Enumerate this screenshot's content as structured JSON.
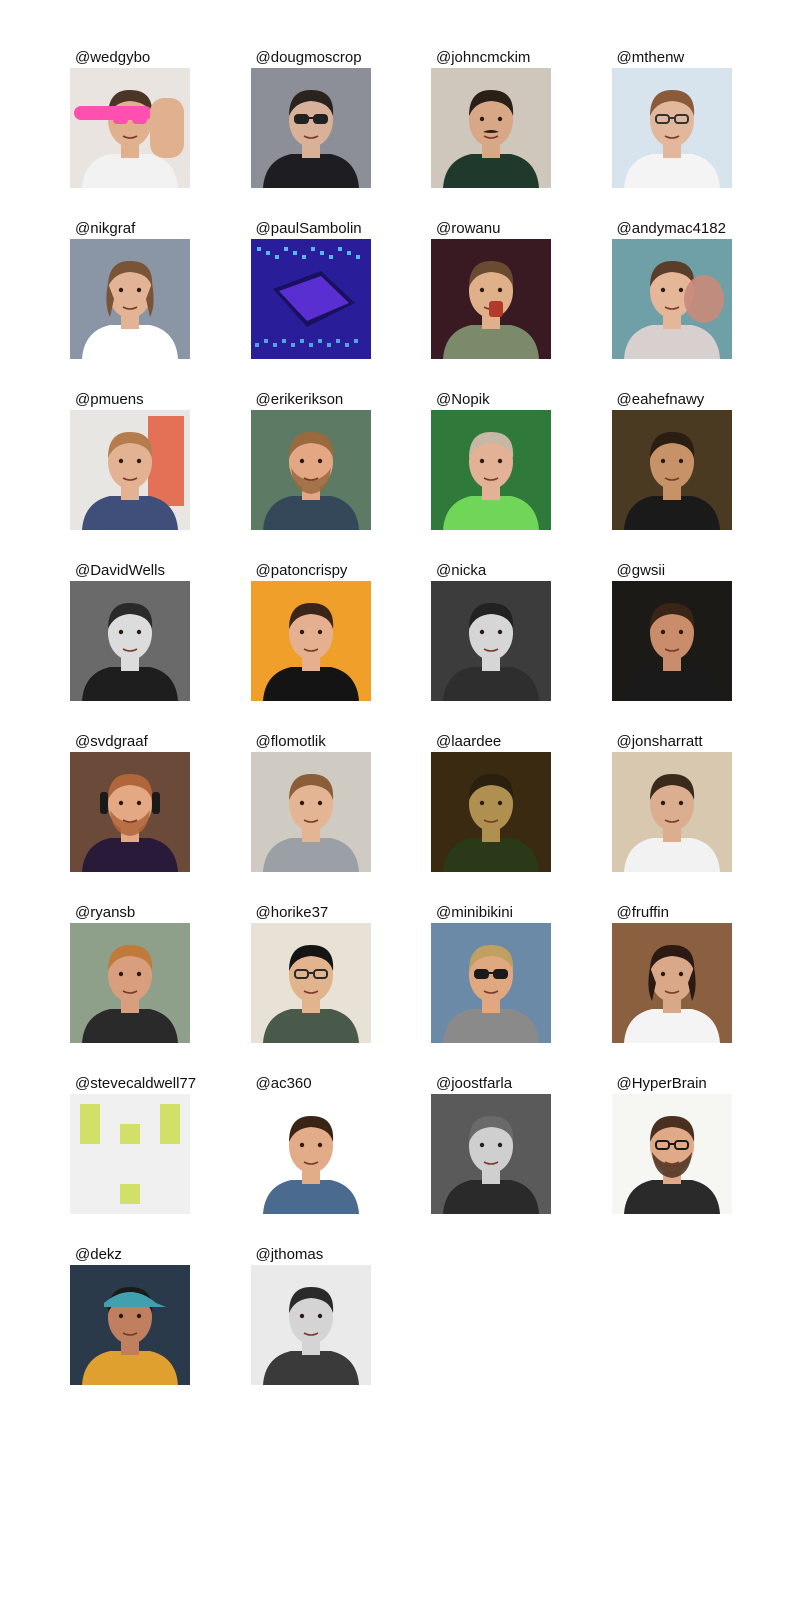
{
  "contributors": [
    {
      "handle": "@wedgybo",
      "avatar": "person-with-rainbow-sunglasses-portrait",
      "palette": {
        "bg": "#e9e4df",
        "skin": "#e0b08f",
        "hair": "#4a3526",
        "shirt": "#f2f2f2",
        "extra": "#ff4fb0"
      }
    },
    {
      "handle": "@dougmoscrop",
      "avatar": "person-with-sunglasses-portrait",
      "palette": {
        "bg": "#8c8f97",
        "skin": "#d9b098",
        "hair": "#2a2320",
        "shirt": "#1e1e22",
        "extra": "#222222"
      }
    },
    {
      "handle": "@johncmckim",
      "avatar": "person-with-mustache-portrait",
      "palette": {
        "bg": "#cfc7bb",
        "skin": "#d8a886",
        "hair": "#2b2018",
        "shirt": "#1f3a2c",
        "extra": "#8aa39a"
      }
    },
    {
      "handle": "@mthenw",
      "avatar": "person-with-glasses-portrait",
      "palette": {
        "bg": "#d7e4ee",
        "skin": "#e3b79c",
        "hair": "#8a5a3a",
        "shirt": "#f4f4f4",
        "extra": "#333333"
      }
    },
    {
      "handle": "@nikgraf",
      "avatar": "person-long-hair-portrait",
      "palette": {
        "bg": "#8a96a6",
        "skin": "#e2b394",
        "hair": "#7a5436",
        "shirt": "#ffffff",
        "extra": "#5c6a7c"
      }
    },
    {
      "handle": "@paulSambolin",
      "avatar": "microchip-photo",
      "palette": {
        "bg": "#2a1d9a",
        "skin": "#5a2fd1",
        "hair": "#3a1c8a",
        "shirt": "#1a1060",
        "extra": "#62e0ff"
      }
    },
    {
      "handle": "@rowanu",
      "avatar": "person-drinking-portrait",
      "palette": {
        "bg": "#3a1a22",
        "skin": "#e0b08a",
        "hair": "#6a4a30",
        "shirt": "#7b8a6a",
        "extra": "#b23a2a"
      }
    },
    {
      "handle": "@andymac4182",
      "avatar": "couple-portrait",
      "palette": {
        "bg": "#6fa0a8",
        "skin": "#e6b699",
        "hair": "#5a3e2a",
        "shirt": "#d7d0cf",
        "extra": "#c98a79"
      }
    },
    {
      "handle": "@pmuens",
      "avatar": "speaker-on-stage-photo",
      "palette": {
        "bg": "#e8e6e3",
        "skin": "#e3b293",
        "hair": "#b57d4e",
        "shirt": "#3f4f7a",
        "extra": "#e35a3c"
      }
    },
    {
      "handle": "@erikerikson",
      "avatar": "bearded-person-portrait",
      "palette": {
        "bg": "#5c7a64",
        "skin": "#e4a784",
        "hair": "#9a6a3e",
        "shirt": "#35485a",
        "extra": "#a7b9c8"
      }
    },
    {
      "handle": "@Nopik",
      "avatar": "person-relaxing-portrait",
      "palette": {
        "bg": "#2f7a3a",
        "skin": "#e2b196",
        "hair": "#c7b8a6",
        "shirt": "#6fd65a",
        "extra": "#1b1b1b"
      }
    },
    {
      "handle": "@eahefnawy",
      "avatar": "person-smiling-portrait",
      "palette": {
        "bg": "#4a3a22",
        "skin": "#c89268",
        "hair": "#2a1d12",
        "shirt": "#1a1a1a",
        "extra": "#d8b040"
      }
    },
    {
      "handle": "@DavidWells",
      "avatar": "person-black-and-white-portrait",
      "palette": {
        "bg": "#6a6a6a",
        "skin": "#dcdcdc",
        "hair": "#2a2a2a",
        "shirt": "#1e1e1e",
        "extra": "#9a9a9a"
      }
    },
    {
      "handle": "@patoncrispy",
      "avatar": "person-in-suit-portrait",
      "palette": {
        "bg": "#f0a02a",
        "skin": "#e4b090",
        "hair": "#3a2518",
        "shirt": "#141414",
        "extra": "#ffffff"
      }
    },
    {
      "handle": "@nicka",
      "avatar": "person-black-and-white-portrait",
      "palette": {
        "bg": "#3c3c3c",
        "skin": "#d6d6d6",
        "hair": "#222222",
        "shirt": "#2e2e2e",
        "extra": "#8c8c8c"
      }
    },
    {
      "handle": "@gwsii",
      "avatar": "person-squinting-portrait",
      "palette": {
        "bg": "#1c1a16",
        "skin": "#c98d6c",
        "hair": "#3a2418",
        "shirt": "#1a1a1a",
        "extra": "#5a4030"
      }
    },
    {
      "handle": "@svdgraaf",
      "avatar": "person-with-headphones-portrait",
      "palette": {
        "bg": "#6b4a3a",
        "skin": "#e4a884",
        "hair": "#b0653a",
        "shirt": "#2a1a3a",
        "extra": "#1a1a1a"
      }
    },
    {
      "handle": "@flomotlik",
      "avatar": "person-smiling-portrait",
      "palette": {
        "bg": "#cfcac2",
        "skin": "#e3b594",
        "hair": "#8a5e38",
        "shirt": "#9aa0a6",
        "extra": "#7a8088"
      }
    },
    {
      "handle": "@laardee",
      "avatar": "person-in-dim-light-portrait",
      "palette": {
        "bg": "#3a2a12",
        "skin": "#b09050",
        "hair": "#2a2010",
        "shirt": "#2a3a18",
        "extra": "#d08a2a"
      }
    },
    {
      "handle": "@jonsharratt",
      "avatar": "person-vintage-portrait",
      "palette": {
        "bg": "#d8c8b0",
        "skin": "#dcae90",
        "hair": "#3a2a1a",
        "shirt": "#f2f2f2",
        "extra": "#6a5a4a"
      }
    },
    {
      "handle": "@ryansb",
      "avatar": "person-selfie-portrait",
      "palette": {
        "bg": "#8fa08a",
        "skin": "#d89e7e",
        "hair": "#c07a3a",
        "shirt": "#2a2a2a",
        "extra": "#e8e0c0"
      }
    },
    {
      "handle": "@horike37",
      "avatar": "person-with-glasses-portrait",
      "palette": {
        "bg": "#e8e2d6",
        "skin": "#e2b48e",
        "hair": "#141414",
        "shirt": "#4a5a4a",
        "extra": "#2a2a2a"
      }
    },
    {
      "handle": "@minibikini",
      "avatar": "person-with-sunglasses-portrait",
      "palette": {
        "bg": "#6a8aa8",
        "skin": "#e0a880",
        "hair": "#c0a060",
        "shirt": "#8a8a8a",
        "extra": "#1a1a1a"
      }
    },
    {
      "handle": "@fruffin",
      "avatar": "person-ponytail-portrait",
      "palette": {
        "bg": "#8a6040",
        "skin": "#d9a888",
        "hair": "#2a1a12",
        "shirt": "#f4f4f4",
        "extra": "#6a4a30"
      }
    },
    {
      "handle": "@stevecaldwell77",
      "avatar": "generated-identicon",
      "palette": {
        "bg": "#f0f0f0",
        "skin": "#d2e06a",
        "hair": "#d2e06a",
        "shirt": "#f0f0f0",
        "extra": "#d2e06a"
      }
    },
    {
      "handle": "@ac360",
      "avatar": "person-curly-hair-portrait",
      "palette": {
        "bg": "#ffffff",
        "skin": "#e2ac88",
        "hair": "#3a2416",
        "shirt": "#4a6a90",
        "extra": "#9a8a9a"
      }
    },
    {
      "handle": "@joostfarla",
      "avatar": "person-black-and-white-portrait",
      "palette": {
        "bg": "#5a5a5a",
        "skin": "#cfcfcf",
        "hair": "#6a6a6a",
        "shirt": "#2a2a2a",
        "extra": "#9a9a9a"
      }
    },
    {
      "handle": "@HyperBrain",
      "avatar": "person-with-glasses-beard-portrait",
      "palette": {
        "bg": "#f6f6f2",
        "skin": "#e0aa88",
        "hair": "#4a3020",
        "shirt": "#2a2a2a",
        "extra": "#1a1a1a"
      }
    },
    {
      "handle": "@dekz",
      "avatar": "person-with-cap-illustration",
      "palette": {
        "bg": "#2a3a4a",
        "skin": "#c08060",
        "hair": "#1a1a1a",
        "shirt": "#e0a030",
        "extra": "#40a0b0"
      }
    },
    {
      "handle": "@jthomas",
      "avatar": "person-black-and-white-portrait",
      "palette": {
        "bg": "#eaeaea",
        "skin": "#d4d4d4",
        "hair": "#2a2a2a",
        "shirt": "#3a3a3a",
        "extra": "#8a8a8a"
      }
    }
  ]
}
